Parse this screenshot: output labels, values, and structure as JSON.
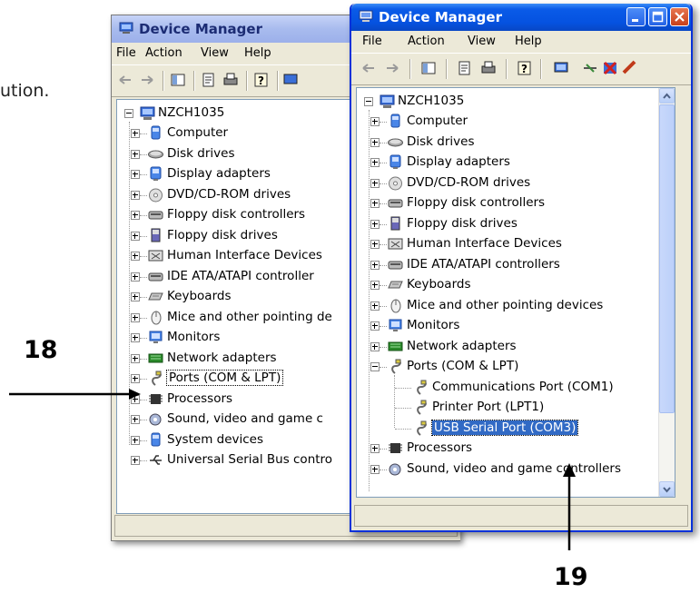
{
  "bg_text": "ution.",
  "windows": {
    "back": {
      "title": "Device Manager",
      "menu": [
        "File",
        "Action",
        "View",
        "Help"
      ],
      "tree_root": "NZCH1035",
      "items": [
        "Computer",
        "Disk drives",
        "Display adapters",
        "DVD/CD-ROM drives",
        "Floppy disk controllers",
        "Floppy disk drives",
        "Human Interface Devices",
        "IDE ATA/ATAPI controller",
        "Keyboards",
        "Mice and other pointing de",
        "Monitors",
        "Network adapters",
        "Ports (COM & LPT)",
        "Processors",
        "Sound, video and game c",
        "System devices",
        "Universal Serial Bus contro"
      ]
    },
    "front": {
      "title": "Device Manager",
      "menu": [
        "File",
        "Action",
        "View",
        "Help"
      ],
      "tree_root": "NZCH1035",
      "items": [
        "Computer",
        "Disk drives",
        "Display adapters",
        "DVD/CD-ROM drives",
        "Floppy disk controllers",
        "Floppy disk drives",
        "Human Interface Devices",
        "IDE ATA/ATAPI controllers",
        "Keyboards",
        "Mice and other pointing devices",
        "Monitors",
        "Network adapters",
        "Ports (COM & LPT)"
      ],
      "ports_children": [
        "Communications Port (COM1)",
        "Printer Port (LPT1)",
        "USB Serial Port (COM3)"
      ],
      "after_items": [
        "Processors",
        "Sound, video and game controllers"
      ]
    }
  },
  "callouts": {
    "a": "18",
    "b": "19"
  },
  "colors": {
    "selection": "#316ac5",
    "title_active": "#0a5be8"
  }
}
